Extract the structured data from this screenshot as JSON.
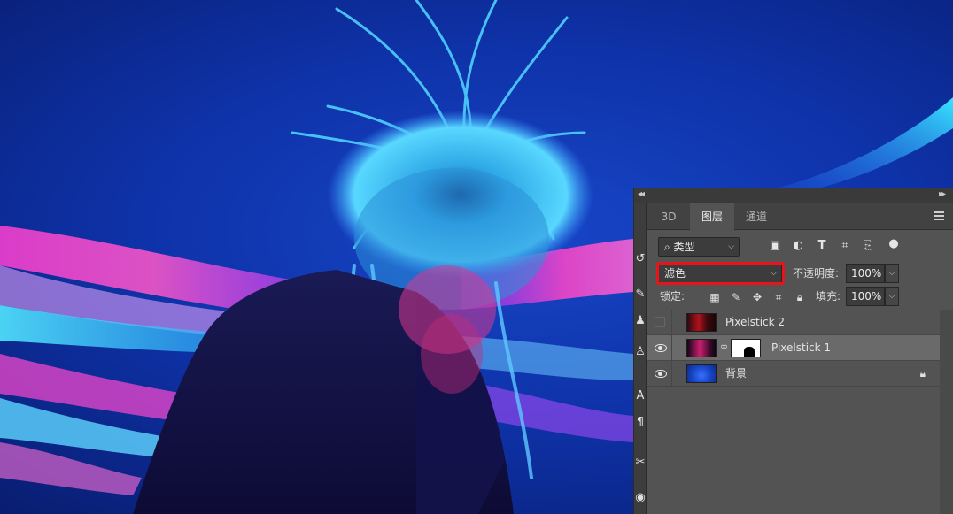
{
  "panel": {
    "tabs": [
      {
        "label": "3D",
        "active": false
      },
      {
        "label": "图层",
        "active": true
      },
      {
        "label": "通道",
        "active": false
      }
    ],
    "filter_kind": "类型",
    "blend_mode": "滤色",
    "opacity_label": "不透明度:",
    "opacity_value": "100%",
    "lock_label": "锁定:",
    "fill_label": "填充:",
    "fill_value": "100%",
    "filter_icons": [
      "image-filter-icon",
      "adjustment-filter-icon",
      "type-filter-icon",
      "shape-filter-icon",
      "smart-object-filter-icon",
      "filter-toggle-icon"
    ],
    "lock_icons": [
      "lock-transparent-pixels-icon",
      "lock-image-pixels-icon",
      "lock-position-icon",
      "lock-artboard-icon",
      "lock-all-icon"
    ],
    "layers": [
      {
        "name": "Pixelstick 2",
        "visible": false,
        "selected": false,
        "has_mask": false
      },
      {
        "name": "Pixelstick 1",
        "visible": true,
        "selected": true,
        "has_mask": true
      },
      {
        "name": "背景",
        "visible": true,
        "selected": false,
        "locked": true
      }
    ]
  },
  "colors": {
    "highlight_box": "#e8141c",
    "panel_bg": "#535353",
    "selected_layer": "#6a6a6a"
  }
}
